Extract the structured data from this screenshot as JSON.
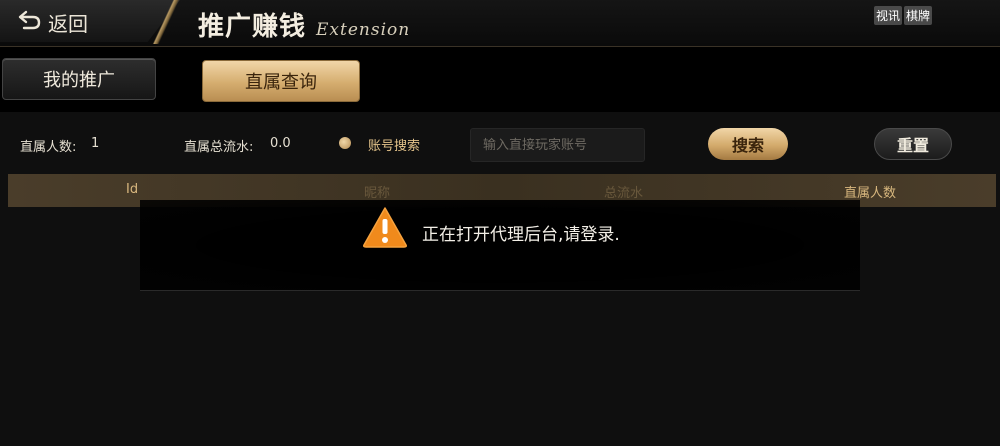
{
  "header": {
    "back_label": "返回",
    "title": "推广赚钱",
    "title_en": "Extension",
    "watermark": [
      "视讯",
      "棋牌"
    ]
  },
  "tabs": [
    {
      "label": "我的推广",
      "active": false
    },
    {
      "label": "直属查询",
      "active": true
    }
  ],
  "filters": {
    "direct_count_label": "直属人数:",
    "direct_count_value": "1",
    "total_flow_label": "直属总流水:",
    "total_flow_value": "0.0",
    "account_search_label": "账号搜索",
    "search_placeholder": "输入直接玩家账号",
    "search_button": "搜索",
    "reset_button": "重置"
  },
  "table": {
    "columns": [
      "Id",
      "昵称",
      "总流水",
      "直属人数"
    ]
  },
  "toast": {
    "icon": "warning-icon",
    "message": "正在打开代理后台,请登录."
  },
  "colors": {
    "accent_gold": "#d5ad6f",
    "header_gold_text": "#d8b77e",
    "warning": "#f08a1c"
  }
}
